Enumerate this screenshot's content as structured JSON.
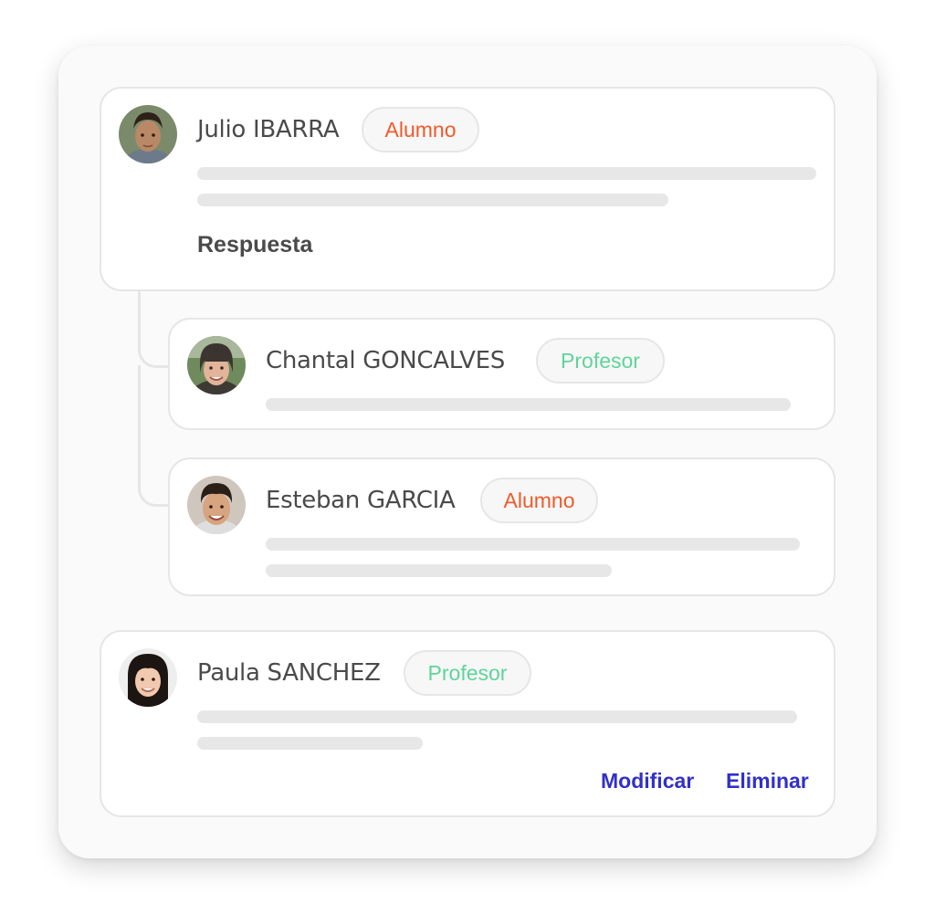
{
  "colors": {
    "alumno": "#f2592a",
    "profesor": "#5fd49a",
    "action": "#3230c8"
  },
  "comments": [
    {
      "name": "Julio IBARRA",
      "role": "Alumno",
      "avatar": "avatar-boy-icon",
      "reply_label": "Respuesta",
      "replies": [
        {
          "name": "Chantal GONCALVES",
          "role": "Profesor",
          "avatar": "avatar-woman-icon"
        },
        {
          "name": "Esteban GARCIA",
          "role": "Alumno",
          "avatar": "avatar-child-icon"
        }
      ]
    },
    {
      "name": "Paula SANCHEZ",
      "role": "Profesor",
      "avatar": "avatar-girl-icon",
      "actions": {
        "edit": "Modificar",
        "delete": "Eliminar"
      }
    }
  ]
}
